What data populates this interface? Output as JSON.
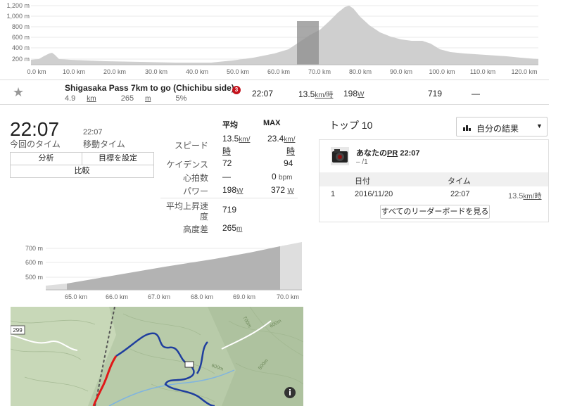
{
  "elevation_chart": {
    "y_ticks": [
      "1,200 m",
      "1,000 m",
      "800 m",
      "600 m",
      "400 m",
      "200 m"
    ],
    "x_ticks": [
      "0.0 km",
      "10.0 km",
      "20.0 km",
      "30.0 km",
      "40.0 km",
      "50.0 km",
      "60.0 km",
      "70.0 km",
      "80.0 km",
      "90.0 km",
      "100.0 km",
      "110.0 km",
      "120.0 km"
    ]
  },
  "segment": {
    "name": "Shigasaka Pass 7km to go (Chichibu side)",
    "distance": "4.9",
    "distance_unit": "km",
    "elevation": "265",
    "elevation_unit": "m",
    "grade": "5%",
    "rank_badge": "3",
    "time": "22:07",
    "speed": "13.5",
    "speed_unit": "km/時",
    "power": "198",
    "power_unit": "W",
    "vam": "719",
    "dash": "—"
  },
  "effort": {
    "time": "22:07",
    "time_label": "今回のタイム",
    "moving_time": "22:07",
    "moving_label": "移動タイム",
    "btn_analysis": "分析",
    "btn_goal": "目標を設定",
    "btn_compare": "比較"
  },
  "stats": {
    "hdr_avg": "平均",
    "hdr_max": "MAX",
    "speed_label": "スピード",
    "speed_avg": "13.5",
    "speed_max": "23.4",
    "speed_unit_a": "km/",
    "speed_unit_b": "時",
    "cadence_label": "ケイデンス",
    "cadence_avg": "72",
    "cadence_max": "94",
    "hr_label": "心拍数",
    "hr_avg": "—",
    "hr_max": "0",
    "hr_unit": "bpm",
    "power_label": "パワー",
    "power_avg": "198",
    "power_max": "372",
    "power_unit": "W",
    "vam_label_a": "平均上昇速",
    "vam_label_b": "度",
    "vam_value": "719",
    "elev_label": "高度差",
    "elev_value": "265",
    "elev_unit": "m"
  },
  "segment_chart": {
    "y_ticks": [
      "700 m",
      "600 m",
      "500 m"
    ],
    "x_ticks": [
      "65.0 km",
      "66.0 km",
      "67.0 km",
      "68.0 km",
      "69.0 km",
      "70.0 km"
    ]
  },
  "top10": {
    "title": "トップ 10",
    "dropdown_label": "自分の結果",
    "pr_prefix": "あなたの",
    "pr_label": "PR",
    "pr_time": "22:07",
    "pr_rank": "– /1",
    "col_date": "日付",
    "col_time": "タイム",
    "rows": [
      {
        "rank": "1",
        "date": "2016/11/20",
        "time": "22:07",
        "speed": "13.5",
        "speed_unit": "km/時"
      }
    ],
    "leaderboard_button": "すべてのリーダーボードを見る"
  },
  "map": {
    "road_number": "299",
    "contours": [
      "700m",
      "600m",
      "500m",
      "600m"
    ]
  }
}
